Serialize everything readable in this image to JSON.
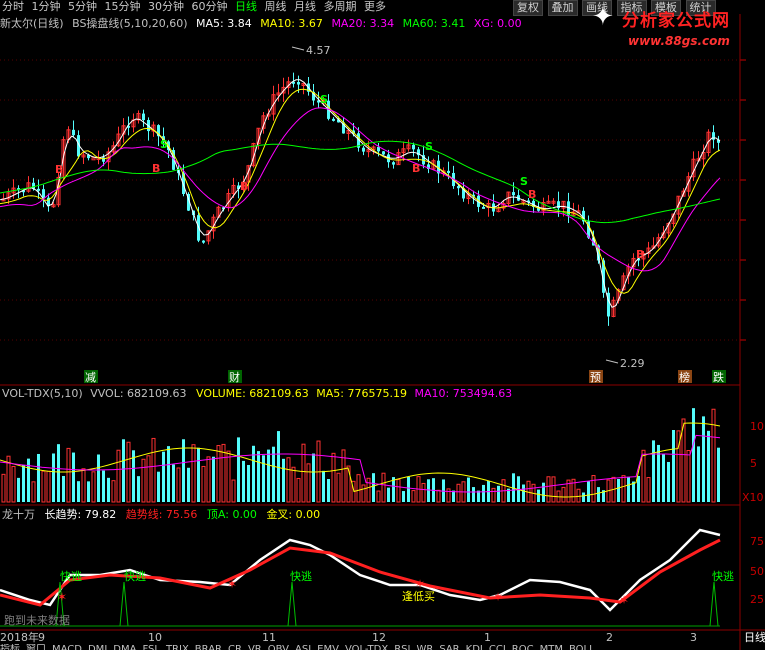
{
  "toolbar": {
    "periods": [
      "分时",
      "1分钟",
      "5分钟",
      "15分钟",
      "30分钟",
      "60分钟",
      "日线",
      "周线",
      "月线",
      "多周期",
      "更多"
    ],
    "active": "日线",
    "right_buttons": [
      "复权",
      "叠加",
      "画线",
      "指标",
      "模板",
      "统计"
    ]
  },
  "watermark": {
    "title": "分析家公式网",
    "url": "www.88gs.com"
  },
  "main_panel": {
    "stock": "新太尔(日线)",
    "indicator": "BS操盘线(5,10,20,60)",
    "ma5_label": "MA5: 3.84",
    "ma10_label": "MA10: 3.67",
    "ma20_label": "MA20: 3.34",
    "ma60_label": "MA60: 3.41",
    "xg_label": "XG: 0.00",
    "high_label": "4.57",
    "low_label": "2.29",
    "markers": [
      "减",
      "财",
      "预",
      "榜",
      "跌"
    ],
    "colors": {
      "ma5": "#ffffff",
      "ma10": "#ffff00",
      "ma20": "#ff00ff",
      "ma60": "#00ff00",
      "up": "#ff3232",
      "down": "#54fcfc"
    }
  },
  "volume_panel": {
    "indicator": "VOL-TDX(5,10)",
    "vvol_label": "VVOL: 682109.63",
    "volume_label": "VOLUME: 682109.63",
    "ma5_label": "MA5: 776575.19",
    "ma10_label": "MA10: 753494.63",
    "axis_10": "10",
    "axis_5": "5",
    "unit": "X10"
  },
  "lower_panel": {
    "indicator": "龙十万",
    "long_label": "长趋势: 79.82",
    "trend_label": "趋势线: 75.56",
    "top_label": "顶A: 0.00",
    "gold_label": "金叉: 0.00",
    "escape_label": "快逃",
    "bottom_label": "逢低买",
    "notice": "跑到未来数据",
    "axis": [
      "75",
      "50",
      "25"
    ]
  },
  "dates": [
    "2018年",
    "9",
    "10",
    "11",
    "12",
    "1",
    "2",
    "3"
  ],
  "bottom_right": "日线",
  "bottom_tabs": [
    "指标",
    "窗口",
    "MACD",
    "DMI",
    "DMA",
    "FSL",
    "TRIX",
    "BRAR",
    "CR",
    "VR",
    "OBV",
    "ASI",
    "EMV",
    "VOL-TDX",
    "RSI",
    "WR",
    "SAR",
    "KDJ",
    "CCI",
    "ROC",
    "MTM",
    "BOLL"
  ]
}
